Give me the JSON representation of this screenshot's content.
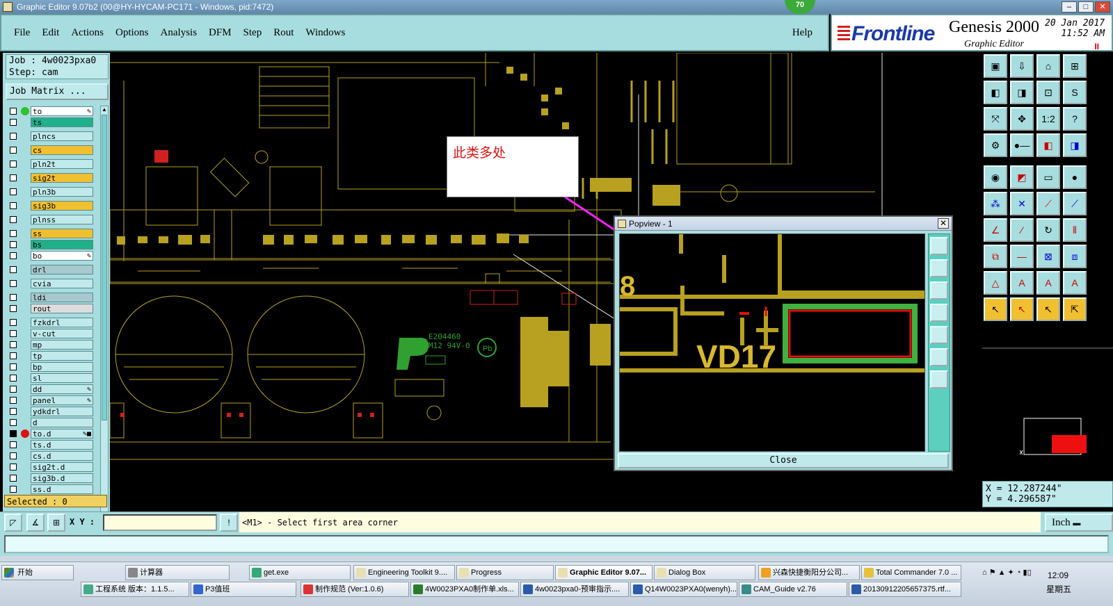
{
  "window": {
    "title": "Graphic Editor 9.07b2 (00@HY-HYCAM-PC171 - Windows, pid:7472)",
    "badge": "70",
    "controls": [
      "–",
      "□",
      "✕"
    ]
  },
  "menu": {
    "items": [
      "File",
      "Edit",
      "Actions",
      "Options",
      "Analysis",
      "DFM",
      "Step",
      "Rout",
      "Windows"
    ],
    "help": "Help"
  },
  "brand": {
    "logo": "Frontline",
    "product": "Genesis 2000",
    "subtitle": "Graphic Editor",
    "date": "20 Jan 2017",
    "time": "11:52 AM",
    "pause": "II"
  },
  "job": {
    "job": "Job : 4w0023pxa0",
    "step": "Step: cam",
    "matrix": "Job Matrix ..."
  },
  "layers": [
    {
      "name": "to",
      "color": "#ffffff",
      "dot": "#30c030",
      "flag": "✎"
    },
    {
      "name": "ts",
      "color": "#20b08a"
    },
    {
      "name": "plncs",
      "color": "#bfe9eb",
      "gap": true
    },
    {
      "name": "cs",
      "color": "#f0c030",
      "gap": true
    },
    {
      "name": "pln2t",
      "color": "#bfe9eb",
      "gap": true
    },
    {
      "name": "sig2t",
      "color": "#f0c030",
      "gap": true
    },
    {
      "name": "pln3b",
      "color": "#bfe9eb",
      "gap": true
    },
    {
      "name": "sig3b",
      "color": "#f0c030",
      "gap": true
    },
    {
      "name": "plnss",
      "color": "#bfe9eb",
      "gap": true
    },
    {
      "name": "ss",
      "color": "#f0c030",
      "gap": true
    },
    {
      "name": "bs",
      "color": "#20b08a"
    },
    {
      "name": "bo",
      "color": "#ffffff",
      "flag": "✎"
    },
    {
      "name": "drl",
      "color": "#a8c8d0",
      "gap": true
    },
    {
      "name": "cvia",
      "color": "#bfe9eb",
      "gap": true
    },
    {
      "name": "ldi",
      "color": "#a8c8d0",
      "gap": true
    },
    {
      "name": "rout",
      "color": "#dcdcdc"
    },
    {
      "name": "fzkdrl",
      "color": "#bfe9eb",
      "gap": true
    },
    {
      "name": "v-cut",
      "color": "#bfe9eb"
    },
    {
      "name": "mp",
      "color": "#bfe9eb"
    },
    {
      "name": "tp",
      "color": "#bfe9eb"
    },
    {
      "name": "bp",
      "color": "#bfe9eb"
    },
    {
      "name": "sl",
      "color": "#bfe9eb"
    },
    {
      "name": "dd",
      "color": "#bfe9eb",
      "flag": "✎"
    },
    {
      "name": "panel",
      "color": "#bfe9eb",
      "flag": "✎"
    },
    {
      "name": "ydkdrl",
      "color": "#bfe9eb"
    },
    {
      "name": "d",
      "color": "#bfe9eb"
    },
    {
      "name": "to.d",
      "color": "#bfe9eb",
      "dot": "#e01010",
      "flag": "✎■",
      "checked": true
    },
    {
      "name": "ts.d",
      "color": "#bfe9eb"
    },
    {
      "name": "cs.d",
      "color": "#bfe9eb"
    },
    {
      "name": "sig2t.d",
      "color": "#bfe9eb"
    },
    {
      "name": "sig3b.d",
      "color": "#bfe9eb"
    },
    {
      "name": "ss.d",
      "color": "#bfe9eb"
    }
  ],
  "selected": "Selected : 0",
  "annotation": "此类多处",
  "popview": {
    "title": "Popview - 1",
    "close": "Close",
    "label": "VD17",
    "digit": "8"
  },
  "board_text": {
    "logo1": "E204460",
    "logo2": "M12 94V-0"
  },
  "coords": {
    "x": "X  =  12.287244\"",
    "y": "Y  =  4.296587\""
  },
  "bottom": {
    "xy_label": "X Y :",
    "message": "<M1> - Select first area corner",
    "units": "Inch"
  },
  "taskbar": {
    "start": "开始",
    "row1": [
      "计算器",
      "get.exe",
      "Engineering Toolkit 9....",
      "Progress",
      "Graphic Editor 9.07...",
      "Dialog Box",
      "兴森快捷衡阳分公司...",
      "Total Commander 7.0 ..."
    ],
    "row2": [
      "工程系统  版本：1.1.5...",
      "P3值班",
      "制作规范 (Ver:1.0.6)",
      "4W0023PXA0制作单.xls...",
      "4w0023pxa0-预审指示....",
      "Q14W0023PXA0(wenyh)...",
      "CAM_Guide v2.76",
      "20130912205657375.rtf..."
    ],
    "clock": "12:09",
    "day": "星期五"
  },
  "colors": {
    "panel": "#a8dde0",
    "trace": "#b8a020",
    "pad_green": "#40b040",
    "highlight": "#e01010",
    "arrow": "#ff20ff"
  }
}
